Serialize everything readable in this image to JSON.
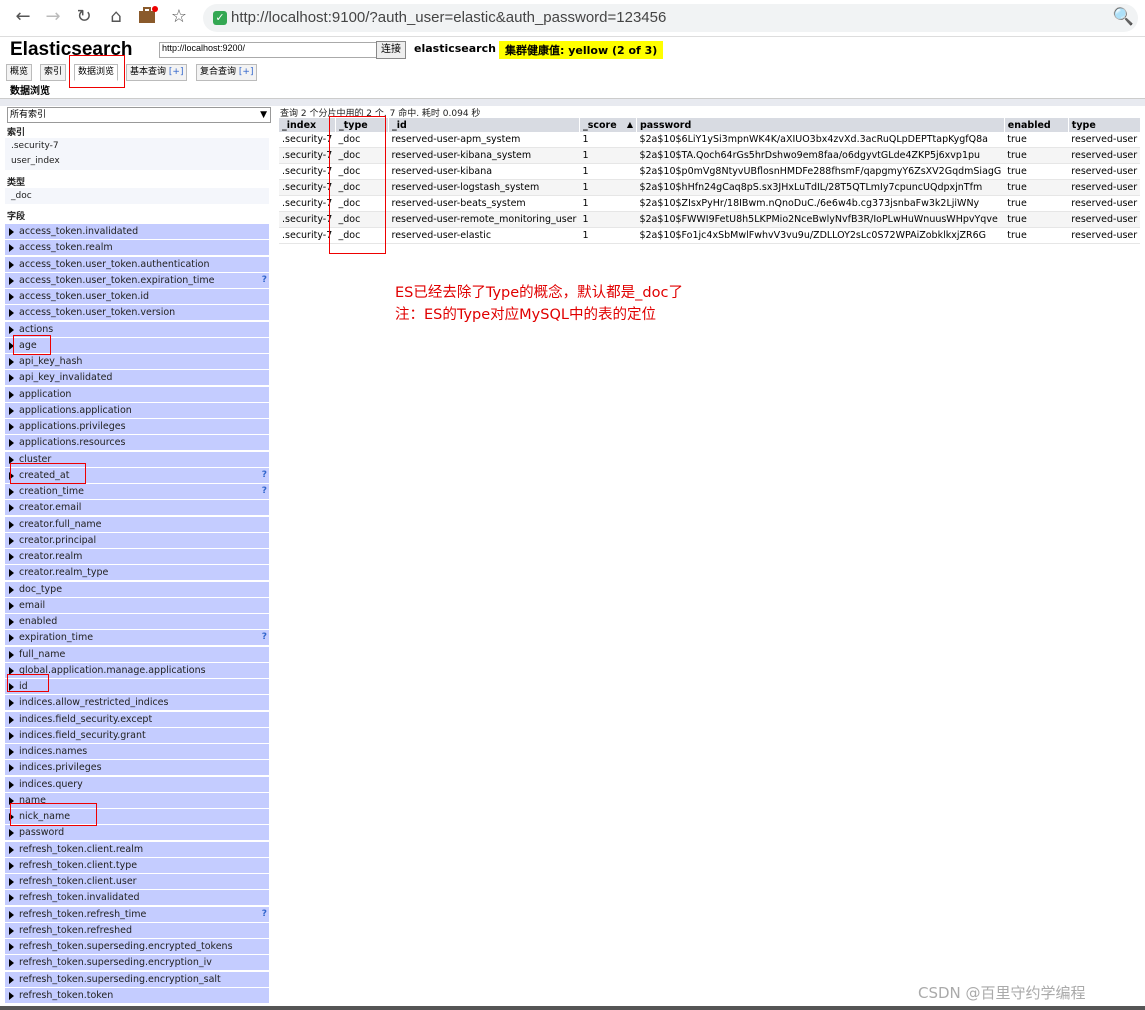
{
  "browser": {
    "url": "http://localhost:9100/?auth_user=elastic&auth_password=123456",
    "icons": [
      "back-icon",
      "forward-icon",
      "reload-icon",
      "home-icon",
      "extension-icon",
      "bookmark-star-icon",
      "zoom-icon"
    ]
  },
  "header": {
    "title": "Elasticsearch",
    "url_input": "http://localhost:9200/",
    "connect": "连接",
    "cluster_name": "elasticsearch",
    "health": "集群健康值: yellow (2 of 3)"
  },
  "tabs": [
    {
      "label": "概览"
    },
    {
      "label": "索引"
    },
    {
      "label": "数据浏览"
    },
    {
      "label": "基本查询",
      "plus": "[+]"
    },
    {
      "label": "复合查询",
      "plus": "[+]"
    }
  ],
  "section_label": "数据浏览",
  "sidebar": {
    "select_value": "所有索引",
    "index_heading": "索引",
    "indices": [
      ".security-7",
      "user_index"
    ],
    "type_heading": "类型",
    "types": [
      "_doc"
    ],
    "fields_heading": "字段",
    "fields": [
      {
        "name": "access_token.invalidated",
        "q": ""
      },
      {
        "name": "access_token.realm",
        "q": ""
      },
      {
        "name": "access_token.user_token.authentication",
        "q": ""
      },
      {
        "name": "access_token.user_token.expiration_time",
        "q": "?"
      },
      {
        "name": "access_token.user_token.id",
        "q": ""
      },
      {
        "name": "access_token.user_token.version",
        "q": ""
      },
      {
        "name": "actions",
        "q": ""
      },
      {
        "name": "age",
        "q": ""
      },
      {
        "name": "api_key_hash",
        "q": ""
      },
      {
        "name": "api_key_invalidated",
        "q": ""
      },
      {
        "name": "application",
        "q": ""
      },
      {
        "name": "applications.application",
        "q": ""
      },
      {
        "name": "applications.privileges",
        "q": ""
      },
      {
        "name": "applications.resources",
        "q": ""
      },
      {
        "name": "cluster",
        "q": ""
      },
      {
        "name": "created_at",
        "q": "?"
      },
      {
        "name": "creation_time",
        "q": "?"
      },
      {
        "name": "creator.email",
        "q": ""
      },
      {
        "name": "creator.full_name",
        "q": ""
      },
      {
        "name": "creator.principal",
        "q": ""
      },
      {
        "name": "creator.realm",
        "q": ""
      },
      {
        "name": "creator.realm_type",
        "q": ""
      },
      {
        "name": "doc_type",
        "q": ""
      },
      {
        "name": "email",
        "q": ""
      },
      {
        "name": "enabled",
        "q": ""
      },
      {
        "name": "expiration_time",
        "q": "?"
      },
      {
        "name": "full_name",
        "q": ""
      },
      {
        "name": "global.application.manage.applications",
        "q": ""
      },
      {
        "name": "id",
        "q": ""
      },
      {
        "name": "indices.allow_restricted_indices",
        "q": ""
      },
      {
        "name": "indices.field_security.except",
        "q": ""
      },
      {
        "name": "indices.field_security.grant",
        "q": ""
      },
      {
        "name": "indices.names",
        "q": ""
      },
      {
        "name": "indices.privileges",
        "q": ""
      },
      {
        "name": "indices.query",
        "q": ""
      },
      {
        "name": "name",
        "q": ""
      },
      {
        "name": "nick_name",
        "q": ""
      },
      {
        "name": "password",
        "q": ""
      },
      {
        "name": "refresh_token.client.realm",
        "q": ""
      },
      {
        "name": "refresh_token.client.type",
        "q": ""
      },
      {
        "name": "refresh_token.client.user",
        "q": ""
      },
      {
        "name": "refresh_token.invalidated",
        "q": ""
      },
      {
        "name": "refresh_token.refresh_time",
        "q": "?"
      },
      {
        "name": "refresh_token.refreshed",
        "q": ""
      },
      {
        "name": "refresh_token.superseding.encrypted_tokens",
        "q": ""
      },
      {
        "name": "refresh_token.superseding.encryption_iv",
        "q": ""
      },
      {
        "name": "refresh_token.superseding.encryption_salt",
        "q": ""
      },
      {
        "name": "refresh_token.token",
        "q": ""
      }
    ]
  },
  "results": {
    "summary": "查询 2 个分片中用的 2 个. 7 命中. 耗时 0.094 秒",
    "columns": [
      "_index",
      "_type",
      "_id",
      "_score",
      "password",
      "enabled",
      "type"
    ],
    "sort_indicator": "▲",
    "rows": [
      [
        ".security-7",
        "_doc",
        "reserved-user-apm_system",
        "1",
        "$2a$10$6LiY1ySi3mpnWK4K/aXIUO3bx4zvXd.3acRuQLpDEPTtapKygfQ8a",
        "true",
        "reserved-user"
      ],
      [
        ".security-7",
        "_doc",
        "reserved-user-kibana_system",
        "1",
        "$2a$10$TA.Qoch64rGs5hrDshwo9em8faa/o6dgyvtGLde4ZKP5j6xvp1pu",
        "true",
        "reserved-user"
      ],
      [
        ".security-7",
        "_doc",
        "reserved-user-kibana",
        "1",
        "$2a$10$p0mVg8NtyvUBflosnHMDFe288fhsmF/qapgmyY6ZsXV2GqdmSiagG",
        "true",
        "reserved-user"
      ],
      [
        ".security-7",
        "_doc",
        "reserved-user-logstash_system",
        "1",
        "$2a$10$hHfn24gCaq8pS.sx3JHxLuTdIL/28T5QTLmIy7cpuncUQdpxjnTfm",
        "true",
        "reserved-user"
      ],
      [
        ".security-7",
        "_doc",
        "reserved-user-beats_system",
        "1",
        "$2a$10$ZIsxPyHr/18IBwm.nQnoDuC./6e6w4b.cg373jsnbaFw3k2LjiWNy",
        "true",
        "reserved-user"
      ],
      [
        ".security-7",
        "_doc",
        "reserved-user-remote_monitoring_user",
        "1",
        "$2a$10$FWWI9FetU8h5LKPMio2NceBwlyNvfB3R/IoPLwHuWnuusWHpvYqve",
        "true",
        "reserved-user"
      ],
      [
        ".security-7",
        "_doc",
        "reserved-user-elastic",
        "1",
        "$2a$10$Fo1jc4xSbMwlFwhvV3vu9u/ZDLLOY2sLc0S72WPAiZobklkxjZR6G",
        "true",
        "reserved-user"
      ]
    ]
  },
  "annotation": {
    "line1": "ES已经去除了Type的概念，默认都是_doc了",
    "line2": "注：ES的Type对应MySQL中的表的定位",
    "color": "#e00000"
  },
  "watermark": "CSDN @百里守约学编程"
}
